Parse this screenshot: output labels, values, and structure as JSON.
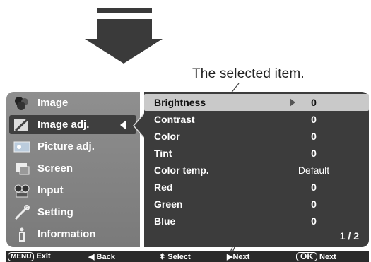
{
  "callout": {
    "text": "The selected item."
  },
  "menu": {
    "items": [
      {
        "label": "Image",
        "icon": "image-icon"
      },
      {
        "label": "Image adj.",
        "icon": "image-adjust-icon",
        "selected": true
      },
      {
        "label": "Picture adj.",
        "icon": "picture-adjust-icon"
      },
      {
        "label": "Screen",
        "icon": "screen-icon"
      },
      {
        "label": "Input",
        "icon": "input-icon"
      },
      {
        "label": "Setting",
        "icon": "setting-icon"
      },
      {
        "label": "Information",
        "icon": "information-icon"
      }
    ]
  },
  "submenu": {
    "rows": [
      {
        "label": "Brightness",
        "value": "0",
        "selected": true
      },
      {
        "label": "Contrast",
        "value": "0"
      },
      {
        "label": "Color",
        "value": "0"
      },
      {
        "label": "Tint",
        "value": "0"
      },
      {
        "label": "Color temp.",
        "value": "Default"
      },
      {
        "label": "Red",
        "value": "0"
      },
      {
        "label": "Green",
        "value": "0"
      },
      {
        "label": "Blue",
        "value": "0"
      }
    ],
    "page": "1 / 2"
  },
  "footer": {
    "menu_key": "MENU",
    "exit": "Exit",
    "back": "Back",
    "select": "Select",
    "next": "Next",
    "ok_key": "OK",
    "ok_next": "Next"
  },
  "colors": {
    "panel_left": "#8a8a8a",
    "panel_right": "#3c3c3c",
    "highlight": "#c9c9c9"
  }
}
